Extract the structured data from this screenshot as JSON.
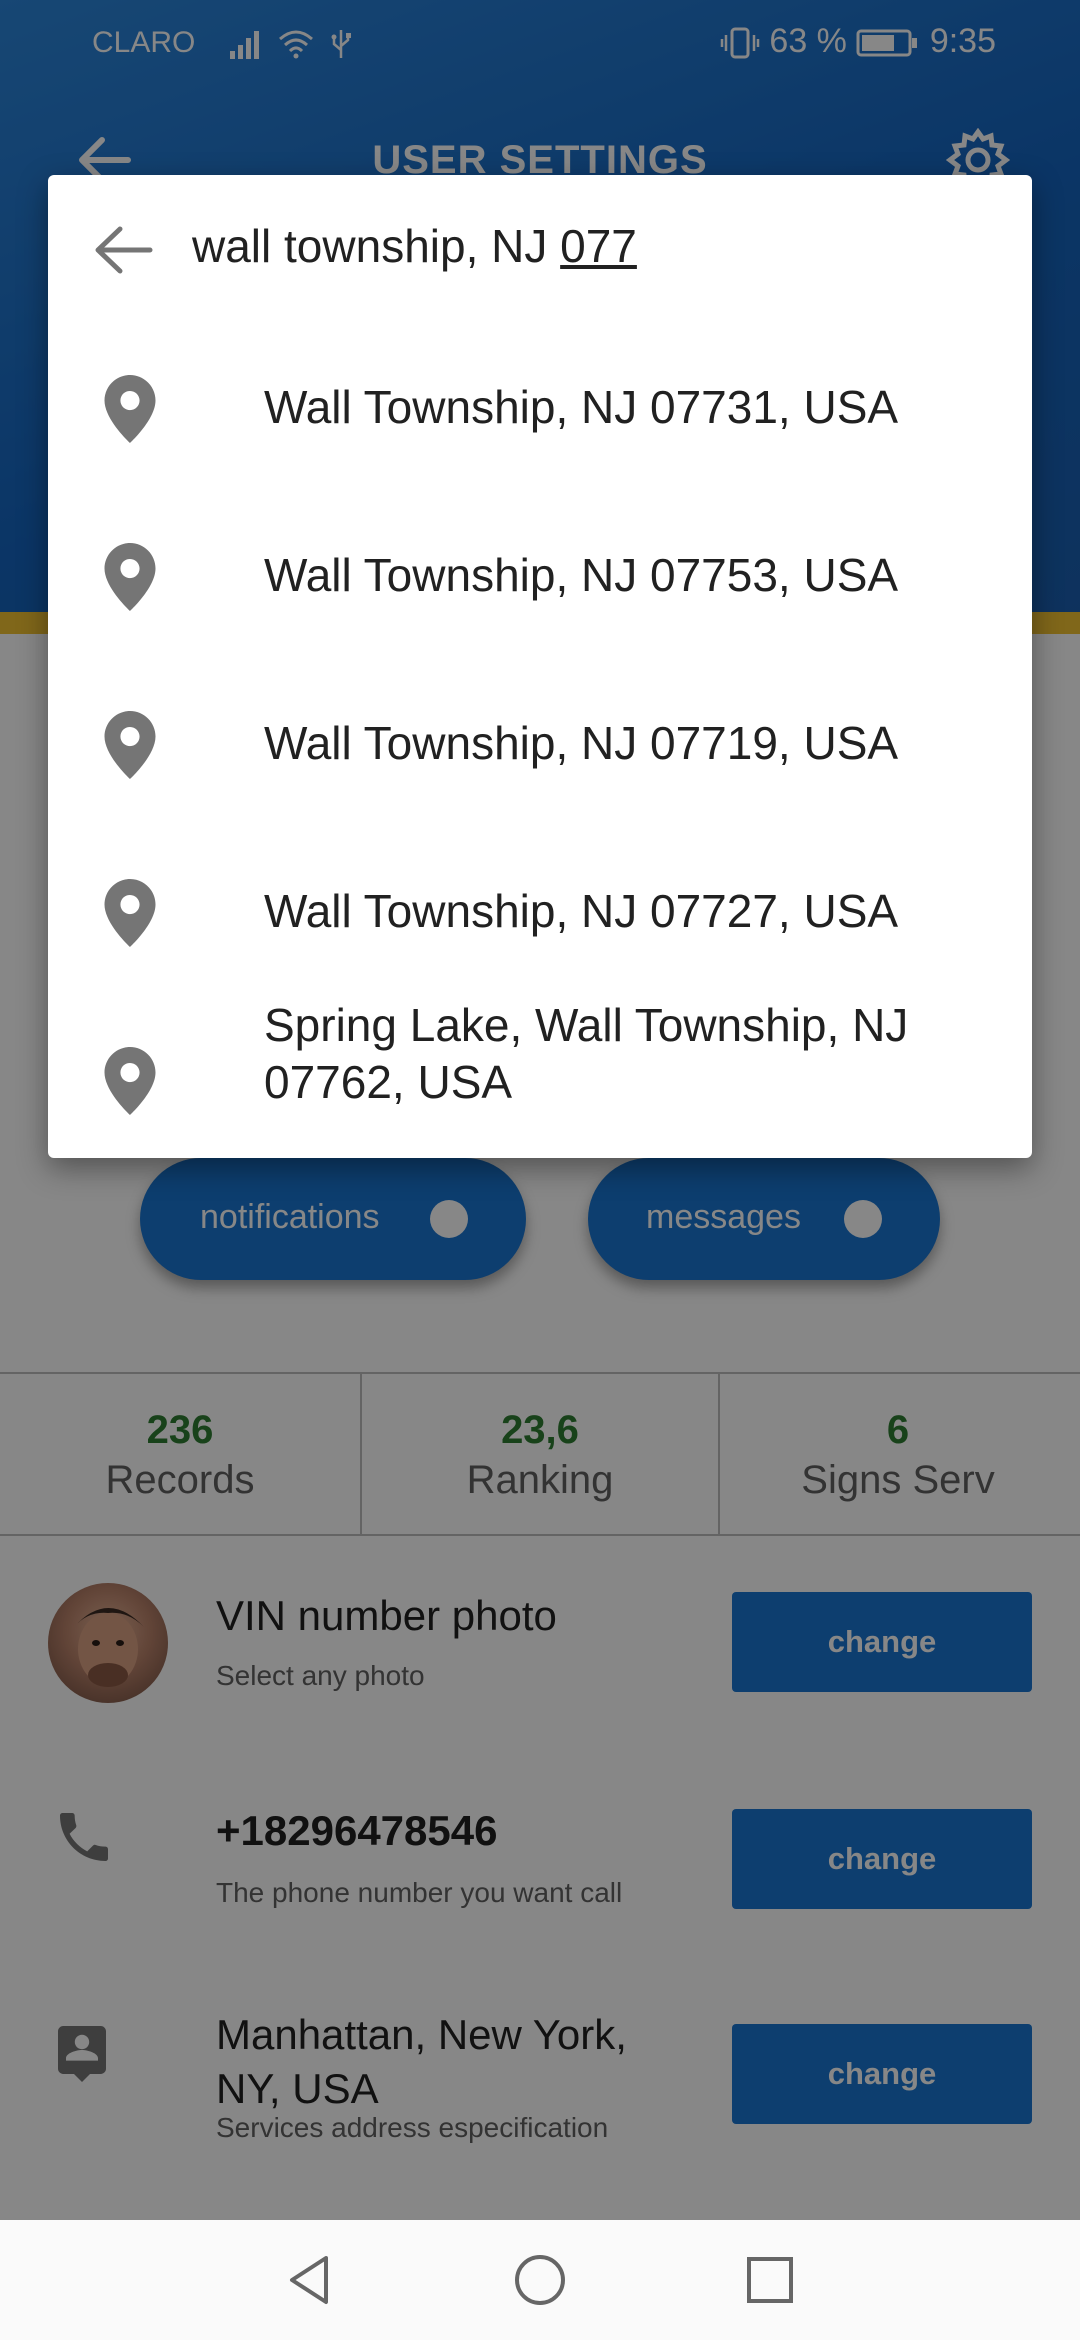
{
  "status_bar": {
    "carrier": "CLARO",
    "battery": "63 %",
    "time": "9:35"
  },
  "toolbar": {
    "title": "USER SETTINGS"
  },
  "toggles": {
    "notifications": "notifications",
    "messages": "messages"
  },
  "stats": [
    {
      "value": "236",
      "label": "Records"
    },
    {
      "value": "23,6",
      "label": "Ranking"
    },
    {
      "value": "6",
      "label": "Signs Serv"
    }
  ],
  "settings": {
    "photo": {
      "title": "VIN number photo",
      "subtitle": "Select any photo",
      "button": "change"
    },
    "phone": {
      "title": "+18296478546",
      "subtitle": "The phone number you want call",
      "button": "change"
    },
    "address": {
      "title": "Manhattan, New York, NY, USA",
      "subtitle": "Services address especification",
      "button": "change"
    }
  },
  "search_dialog": {
    "query_prefix": "wall township, NJ ",
    "query_composing": "077",
    "results": [
      "Wall Township, NJ 07731, USA",
      "Wall Township, NJ 07753, USA",
      "Wall Township, NJ 07719, USA",
      "Wall Township, NJ 07727, USA",
      "Spring Lake, Wall Township, NJ 07762, USA"
    ]
  },
  "colors": {
    "primary": "#1976d2",
    "accent_stripe": "#f1c232",
    "stat_value": "#2e7d32"
  },
  "icons": {
    "status": [
      "signal-icon",
      "wifi-icon",
      "usb-icon",
      "vibrate-icon",
      "battery-icon"
    ],
    "toolbar": [
      "back-arrow-icon",
      "gear-icon"
    ],
    "rows": [
      "phone-icon",
      "contact-card-icon"
    ],
    "dialog": [
      "back-arrow-icon",
      "location-pin-icon"
    ],
    "nav": [
      "nav-back-icon",
      "nav-home-icon",
      "nav-recents-icon"
    ]
  }
}
